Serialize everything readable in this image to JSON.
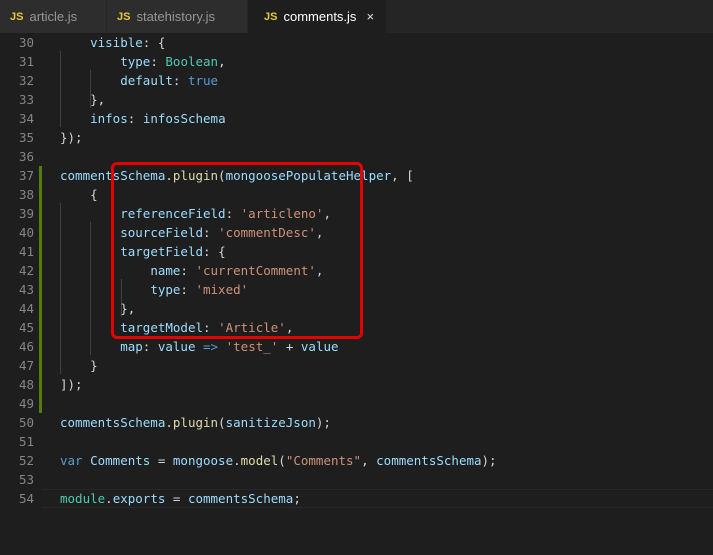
{
  "tabs": [
    {
      "icon": "JS",
      "label": "article.js"
    },
    {
      "icon": "JS",
      "label": "statehistory.js"
    },
    {
      "icon": "JS",
      "label": "comments.js",
      "close": "×"
    }
  ],
  "lines": [
    {
      "n": "30",
      "tokens": [
        [
          "p",
          "    "
        ],
        [
          "k",
          "visible"
        ],
        [
          "p",
          ": {"
        ]
      ]
    },
    {
      "n": "31",
      "tokens": [
        [
          "p",
          "        "
        ],
        [
          "k",
          "type"
        ],
        [
          "p",
          ": "
        ],
        [
          "t",
          "Boolean"
        ],
        [
          "p",
          ","
        ]
      ]
    },
    {
      "n": "32",
      "tokens": [
        [
          "p",
          "        "
        ],
        [
          "k",
          "default"
        ],
        [
          "p",
          ": "
        ],
        [
          "w",
          "true"
        ]
      ]
    },
    {
      "n": "33",
      "tokens": [
        [
          "p",
          "    },"
        ]
      ]
    },
    {
      "n": "34",
      "tokens": [
        [
          "p",
          "    "
        ],
        [
          "k",
          "infos"
        ],
        [
          "p",
          ": "
        ],
        [
          "k",
          "infosSchema"
        ]
      ]
    },
    {
      "n": "35",
      "tokens": [
        [
          "p",
          "});"
        ]
      ]
    },
    {
      "n": "36",
      "tokens": []
    },
    {
      "n": "37",
      "tokens": [
        [
          "k",
          "commentsSchema"
        ],
        [
          "p",
          "."
        ],
        [
          "f",
          "plugin"
        ],
        [
          "p",
          "("
        ],
        [
          "k",
          "mongoosePopulateHelper"
        ],
        [
          "p",
          ", ["
        ]
      ]
    },
    {
      "n": "38",
      "tokens": [
        [
          "p",
          "    {"
        ]
      ]
    },
    {
      "n": "39",
      "tokens": [
        [
          "p",
          "        "
        ],
        [
          "k",
          "referenceField"
        ],
        [
          "p",
          ": "
        ],
        [
          "s",
          "'articleno'"
        ],
        [
          "p",
          ","
        ]
      ]
    },
    {
      "n": "40",
      "tokens": [
        [
          "p",
          "        "
        ],
        [
          "k",
          "sourceField"
        ],
        [
          "p",
          ": "
        ],
        [
          "s",
          "'commentDesc'"
        ],
        [
          "p",
          ","
        ]
      ]
    },
    {
      "n": "41",
      "tokens": [
        [
          "p",
          "        "
        ],
        [
          "k",
          "targetField"
        ],
        [
          "p",
          ": {"
        ]
      ]
    },
    {
      "n": "42",
      "tokens": [
        [
          "p",
          "            "
        ],
        [
          "k",
          "name"
        ],
        [
          "p",
          ": "
        ],
        [
          "s",
          "'currentComment'"
        ],
        [
          "p",
          ","
        ]
      ]
    },
    {
      "n": "43",
      "tokens": [
        [
          "p",
          "            "
        ],
        [
          "k",
          "type"
        ],
        [
          "p",
          ": "
        ],
        [
          "s",
          "'mixed'"
        ]
      ]
    },
    {
      "n": "44",
      "tokens": [
        [
          "p",
          "        },"
        ]
      ]
    },
    {
      "n": "45",
      "tokens": [
        [
          "p",
          "        "
        ],
        [
          "k",
          "targetModel"
        ],
        [
          "p",
          ": "
        ],
        [
          "s",
          "'Article'"
        ],
        [
          "p",
          ","
        ]
      ]
    },
    {
      "n": "46",
      "tokens": [
        [
          "p",
          "        "
        ],
        [
          "k",
          "map"
        ],
        [
          "p",
          ": "
        ],
        [
          "k",
          "value"
        ],
        [
          "p",
          " "
        ],
        [
          "w",
          "=>"
        ],
        [
          "p",
          " "
        ],
        [
          "s",
          "'test_'"
        ],
        [
          "p",
          " + "
        ],
        [
          "k",
          "value"
        ]
      ]
    },
    {
      "n": "47",
      "tokens": [
        [
          "p",
          "    }"
        ]
      ]
    },
    {
      "n": "48",
      "tokens": [
        [
          "p",
          "]);"
        ]
      ]
    },
    {
      "n": "49",
      "tokens": []
    },
    {
      "n": "50",
      "tokens": [
        [
          "k",
          "commentsSchema"
        ],
        [
          "p",
          "."
        ],
        [
          "f",
          "plugin"
        ],
        [
          "p",
          "("
        ],
        [
          "k",
          "sanitizeJson"
        ],
        [
          "p",
          ");"
        ]
      ]
    },
    {
      "n": "51",
      "tokens": []
    },
    {
      "n": "52",
      "tokens": [
        [
          "w",
          "var"
        ],
        [
          "p",
          " "
        ],
        [
          "k",
          "Comments"
        ],
        [
          "p",
          " = "
        ],
        [
          "k",
          "mongoose"
        ],
        [
          "p",
          "."
        ],
        [
          "f",
          "model"
        ],
        [
          "p",
          "("
        ],
        [
          "s",
          "\"Comments\""
        ],
        [
          "p",
          ", "
        ],
        [
          "k",
          "commentsSchema"
        ],
        [
          "p",
          ");"
        ]
      ]
    },
    {
      "n": "53",
      "tokens": []
    },
    {
      "n": "54",
      "tokens": [
        [
          "t",
          "module"
        ],
        [
          "p",
          "."
        ],
        [
          "k",
          "exports"
        ],
        [
          "p",
          " = "
        ],
        [
          "k",
          "commentsSchema"
        ],
        [
          "p",
          ";"
        ]
      ]
    }
  ],
  "colors": {
    "accent_red": "#e60000",
    "gutter_modified": "#587c0c"
  }
}
